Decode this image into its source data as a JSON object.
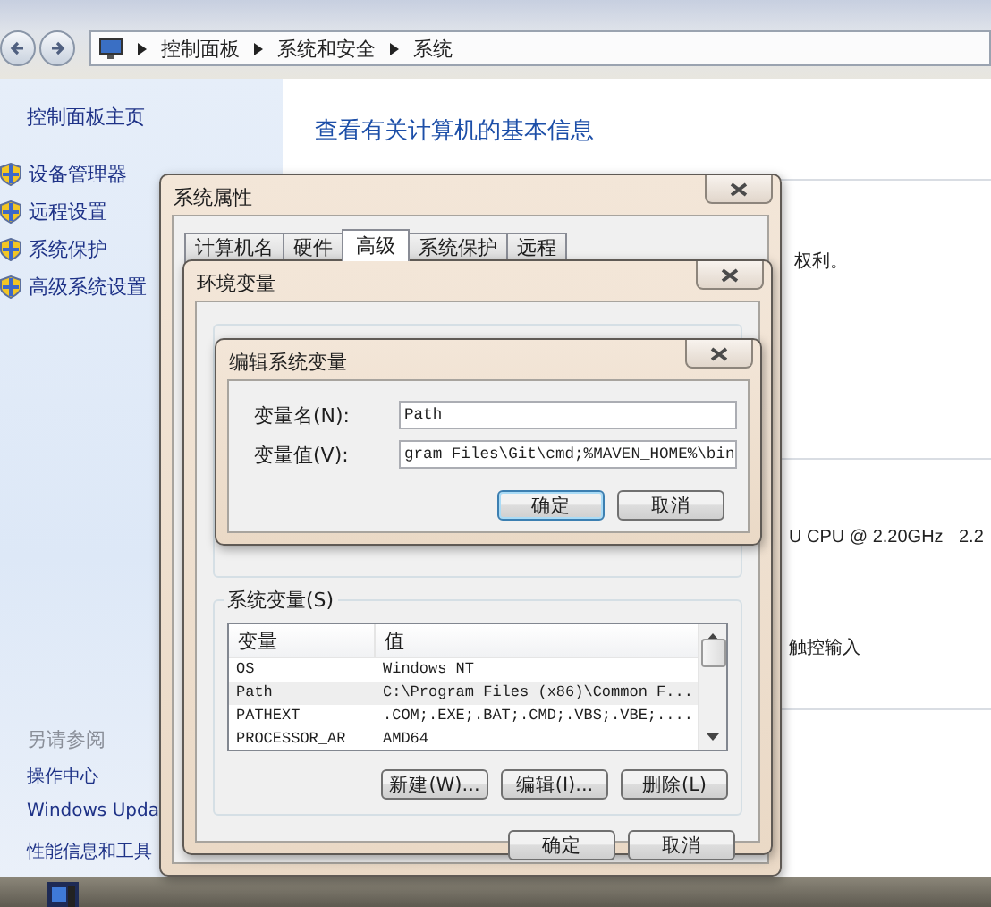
{
  "explorer": {
    "breadcrumb": [
      "控制面板",
      "系统和安全",
      "系统"
    ],
    "sidebar": {
      "home": "控制面板主页",
      "tasks": [
        "设备管理器",
        "远程设置",
        "系统保护",
        "高级系统设置"
      ],
      "see_also_heading": "另请参阅",
      "see_also": [
        "操作中心",
        "Windows Upda",
        "性能信息和工具"
      ]
    },
    "heading": "查看有关计算机的基本信息",
    "rights_text": "权利。",
    "processor_text": "U CPU @ 2.20GHz",
    "speed_text": "2.2",
    "pen_touch_text": "触控输入"
  },
  "system_properties": {
    "title": "系统属性",
    "tabs": [
      {
        "label": "计算机名",
        "selected": false
      },
      {
        "label": "硬件",
        "selected": false
      },
      {
        "label": "高级",
        "selected": true
      },
      {
        "label": "系统保护",
        "selected": false
      },
      {
        "label": "远程",
        "selected": false
      }
    ]
  },
  "environment_variables": {
    "title": "环境变量",
    "system_group": "系统变量(S)",
    "columns": [
      "变量",
      "值"
    ],
    "rows": [
      {
        "name": "OS",
        "value": "Windows_NT",
        "selected": false
      },
      {
        "name": "Path",
        "value": "C:\\Program Files (x86)\\Common F...",
        "selected": true
      },
      {
        "name": "PATHEXT",
        "value": ".COM;.EXE;.BAT;.CMD;.VBS;.VBE;....",
        "selected": false
      },
      {
        "name": "PROCESSOR_AR",
        "value": "AMD64",
        "selected": false
      }
    ],
    "buttons": [
      "新建(W)...",
      "编辑(I)...",
      "删除(L)"
    ],
    "footer_buttons": [
      {
        "label": "确定",
        "default": false
      },
      {
        "label": "取消",
        "default": false
      }
    ]
  },
  "edit_variable": {
    "title": "编辑系统变量",
    "name_label": "变量名(N):",
    "name_value": "Path",
    "value_label": "变量值(V):",
    "value_value": "gram Files\\Git\\cmd;%MAVEN_HOME%\\bin",
    "buttons": [
      {
        "label": "确定",
        "default": true
      },
      {
        "label": "取消",
        "default": false
      }
    ]
  }
}
